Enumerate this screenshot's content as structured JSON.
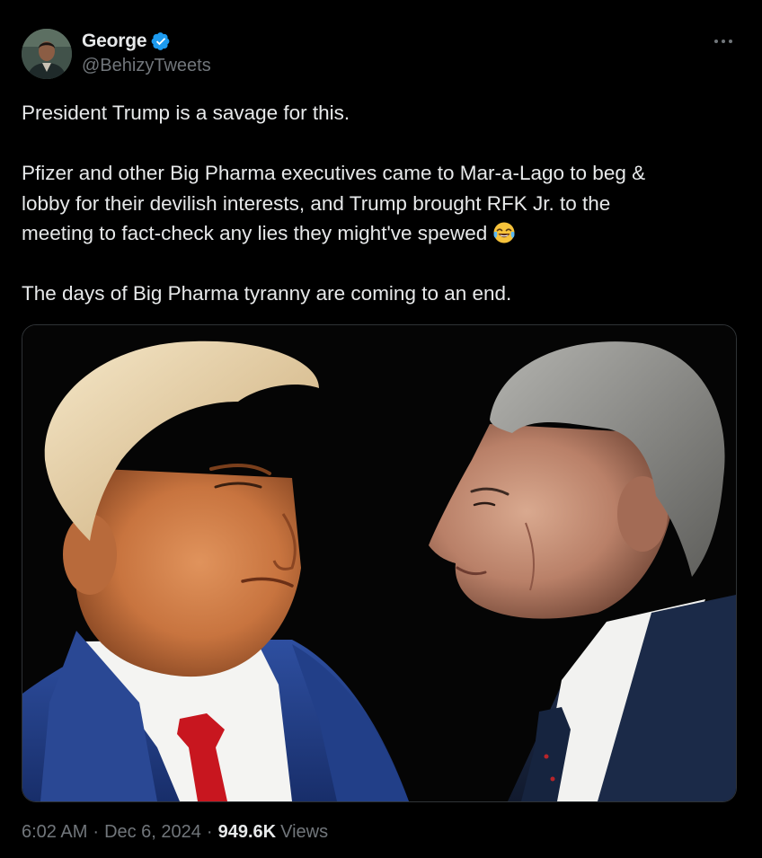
{
  "author": {
    "display_name": "George",
    "handle": "@BehizyTweets",
    "verified": true,
    "verified_color": "#1d9bf0",
    "avatar_icon": "avatar-photo"
  },
  "menu": {
    "icon": "more-horizontal-icon"
  },
  "tweet": {
    "line1": "President Trump is a savage for this.",
    "para2_line1": "Pfizer and other Big Pharma executives came to Mar-a-Lago to beg &",
    "para2_line2": "lobby for their devilish interests, and Trump brought RFK Jr. to the",
    "para2_line3": "meeting to fact-check any lies they might've spewed",
    "para2_emoji": "face-with-tears-of-joy",
    "line_last": "The days of Big Pharma tyranny are coming to an end."
  },
  "media": {
    "type": "photo",
    "content": "two-men-facing-portrait"
  },
  "meta": {
    "time": "6:02 AM",
    "separator": "·",
    "date": "Dec 6, 2024",
    "views_count": "949.6K",
    "views_label": "Views"
  },
  "colors": {
    "background": "#000000",
    "text_primary": "#e7e9ea",
    "text_secondary": "#71767b",
    "border": "#2f3336"
  }
}
